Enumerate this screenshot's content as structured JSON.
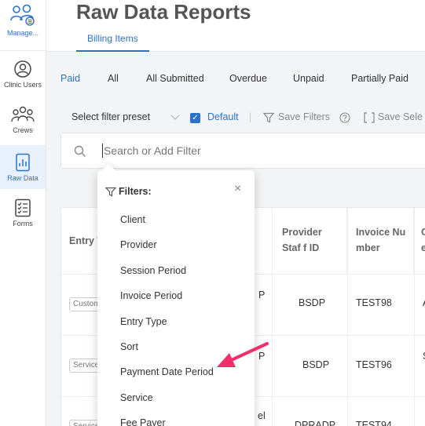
{
  "sidebar": {
    "items": [
      {
        "label": "Manage...",
        "icon": "team-manage-icon"
      },
      {
        "label": "Clinic Users",
        "icon": "user-icon"
      },
      {
        "label": "Crews",
        "icon": "crew-icon"
      },
      {
        "label": "Raw Data",
        "icon": "report-icon",
        "active": true
      },
      {
        "label": "Forms",
        "icon": "forms-list-icon"
      }
    ]
  },
  "header": {
    "title": "Raw Data Reports",
    "sub_tab": "Billing Items"
  },
  "tabs": [
    "Paid",
    "All",
    "All Submitted",
    "Overdue",
    "Unpaid",
    "Partially Paid"
  ],
  "active_tab": "Paid",
  "filter_bar": {
    "preset_label": "Select filter preset",
    "default_label": "Default",
    "save_filters_label": "Save  Filters",
    "save_select_label": "Save  Sele"
  },
  "search": {
    "placeholder": "Search or Add Filter"
  },
  "table": {
    "headers": [
      "Entry T",
      "",
      "Provider Staff ID",
      "Invoice Number",
      "C e"
    ],
    "header_provider_staff": "Provider Staf f ID",
    "header_invoice": "Invoice Nu mber",
    "header_entry": "Entry T",
    "header_last": "C e",
    "rows": [
      {
        "tag": "Custom",
        "col2": "P",
        "staff_id": "BSDP",
        "invoice": "TEST98",
        "last": "A"
      },
      {
        "tag": "Service",
        "col2": "P",
        "staff_id": "BSDP",
        "invoice": "TEST96",
        "last": "S"
      },
      {
        "tag": "Service",
        "col2": "el",
        "staff_id": "DPRADP",
        "invoice": "TEST94",
        "last": ""
      }
    ]
  },
  "dropdown": {
    "title": "Filters:",
    "items": [
      "Client",
      "Provider",
      "Session Period",
      "Invoice Period",
      "Entry Type",
      "Sort",
      "Payment Date Period",
      "Service",
      "Fee Payer"
    ]
  },
  "colors": {
    "accent": "#2b73c9",
    "arrow": "#f0306a"
  }
}
